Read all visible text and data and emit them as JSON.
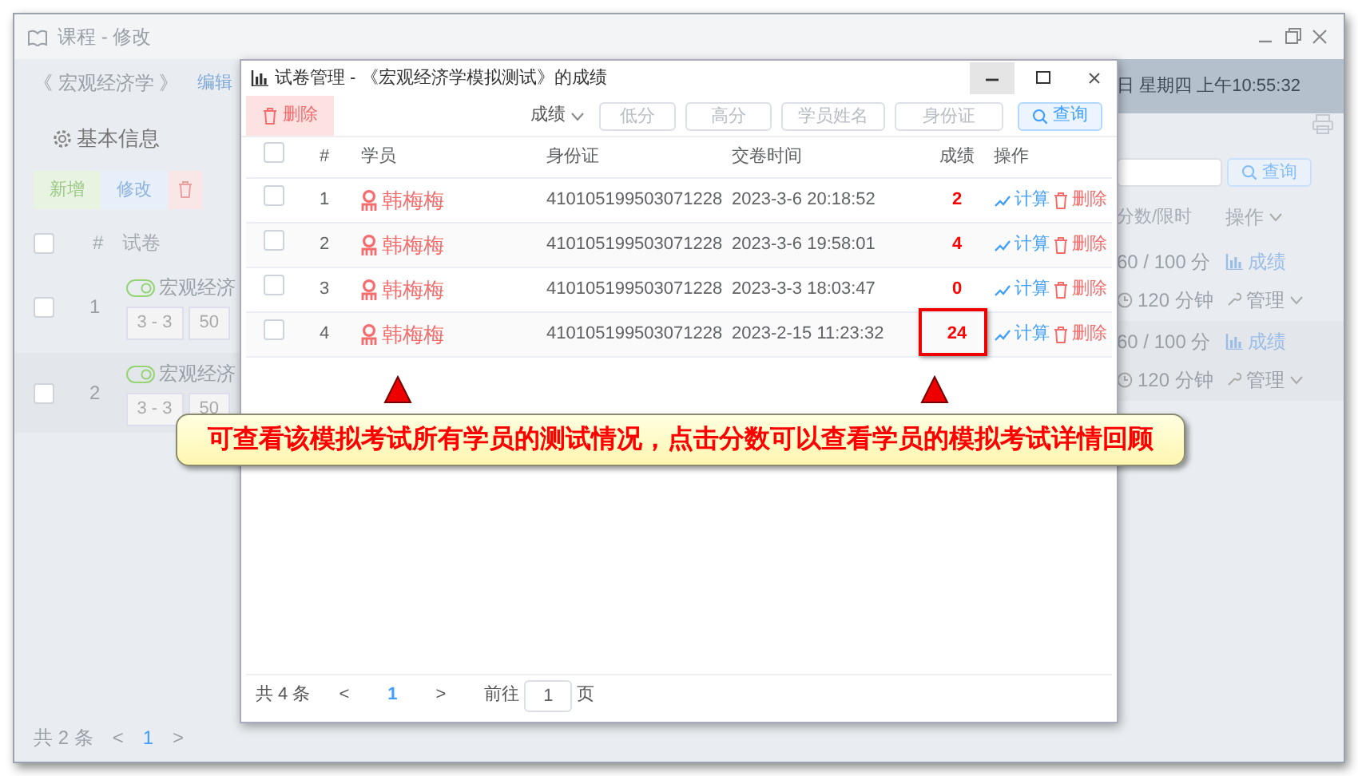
{
  "outer_window": {
    "title": "课程 - 修改",
    "select_all_checked": false,
    "course_title": "《 宏观经济学 》",
    "edit_link": "编辑",
    "tab": "基本信息",
    "toolbar": [
      "新增",
      "修改"
    ],
    "datetime": "日 星期四 上午10:55:32",
    "search_button": "查询",
    "columns": [
      "#",
      "试卷",
      "分数/限时",
      "操作"
    ],
    "rows": [
      {
        "index": "1",
        "checked": false,
        "published": true,
        "title": "宏观经济",
        "tags": [
          "3 - 3",
          "50"
        ],
        "score": "60 / 100 分",
        "time": "120 分钟",
        "actions": [
          "成绩",
          "管理"
        ]
      },
      {
        "index": "2",
        "checked": false,
        "published": true,
        "title": "宏观经济",
        "tags": [
          "3 - 3",
          "50"
        ],
        "score": "60 / 100 分",
        "time": "120 分钟",
        "actions": [
          "成绩",
          "管理"
        ]
      }
    ],
    "pagination": {
      "total": "共 2 条",
      "prev": "<",
      "page": "1",
      "next": ">"
    }
  },
  "dialog": {
    "title": "试卷管理 - 《宏观经济学模拟测试》的成绩",
    "delete_button": "删除",
    "sort": "成绩",
    "filters": [
      {
        "placeholder": "低分"
      },
      {
        "placeholder": "高分"
      },
      {
        "placeholder": "学员姓名"
      },
      {
        "placeholder": "身份证"
      }
    ],
    "search_button": "查询",
    "select_all_checked": false,
    "columns": [
      "#",
      "学员",
      "身份证",
      "交卷时间",
      "成绩",
      "操作"
    ],
    "rows": [
      {
        "index": "1",
        "checked": false,
        "student": "韩梅梅",
        "id_number": "410105199503071228",
        "submitted": "2023-3-6 20:18:52",
        "score": "2",
        "highlighted": false,
        "actions": [
          "计算",
          "删除"
        ]
      },
      {
        "index": "2",
        "checked": false,
        "student": "韩梅梅",
        "id_number": "410105199503071228",
        "submitted": "2023-3-6 19:58:01",
        "score": "4",
        "highlighted": false,
        "actions": [
          "计算",
          "删除"
        ]
      },
      {
        "index": "3",
        "checked": false,
        "student": "韩梅梅",
        "id_number": "410105199503071228",
        "submitted": "2023-3-3 18:03:47",
        "score": "0",
        "highlighted": false,
        "actions": [
          "计算",
          "删除"
        ]
      },
      {
        "index": "4",
        "checked": false,
        "student": "韩梅梅",
        "id_number": "410105199503071228",
        "submitted": "2023-2-15 11:23:32",
        "score": "24",
        "highlighted": true,
        "actions": [
          "计算",
          "删除"
        ]
      }
    ],
    "pagination": {
      "total": "共 4 条",
      "prev": "<",
      "page": "1",
      "next": ">",
      "goto_label": "前往",
      "goto_value": "1",
      "goto_suffix": "页"
    }
  },
  "callout": "可查看该模拟考试所有学员的测试情况，点击分数可以查看学员的模拟考试详情回顾"
}
